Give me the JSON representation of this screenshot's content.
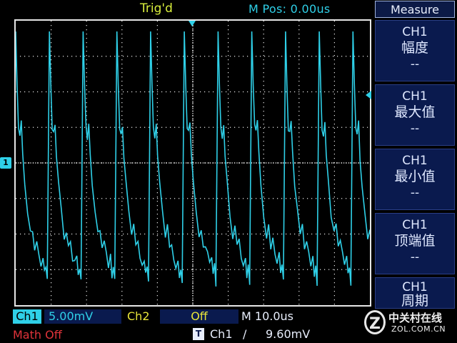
{
  "header": {
    "trigger_status": "Trig'd",
    "m_pos": "M Pos: 0.00us",
    "menu_title": "Measure"
  },
  "measurements": [
    {
      "channel": "CH1",
      "name": "幅度",
      "value": "--"
    },
    {
      "channel": "CH1",
      "name": "最大值",
      "value": "--"
    },
    {
      "channel": "CH1",
      "name": "最小值",
      "value": "--"
    },
    {
      "channel": "CH1",
      "name": "顶端值",
      "value": "--"
    },
    {
      "channel": "CH1",
      "name": "周期",
      "value": ""
    }
  ],
  "markers": {
    "ch1": "1",
    "trigger_source_icon": "T"
  },
  "status": {
    "ch1_label": "Ch1",
    "ch1_scale": "5.00mV",
    "ch2_label": "Ch2",
    "ch2_state": "Off",
    "timebase": "M 10.0us",
    "math": "Math Off",
    "trigger_source": "Ch1",
    "trigger_edge": "/",
    "trigger_level": "9.60mV"
  },
  "watermark": {
    "mark": "Z",
    "name": "中关村在线",
    "url": "ZOL.COM.CN"
  },
  "colors": {
    "trace": "#2fd0e8",
    "grid": "#e6e6e6",
    "menu_bg": "#0a1a4e",
    "ch2": "#e8e53a",
    "math": "#e0333a",
    "trig_status": "#d9ef3c"
  },
  "icons": {
    "trigger_position": "trigger-position-arrow",
    "trigger_level": "trigger-level-arrow",
    "rising_edge": "rising-edge-icon"
  }
}
